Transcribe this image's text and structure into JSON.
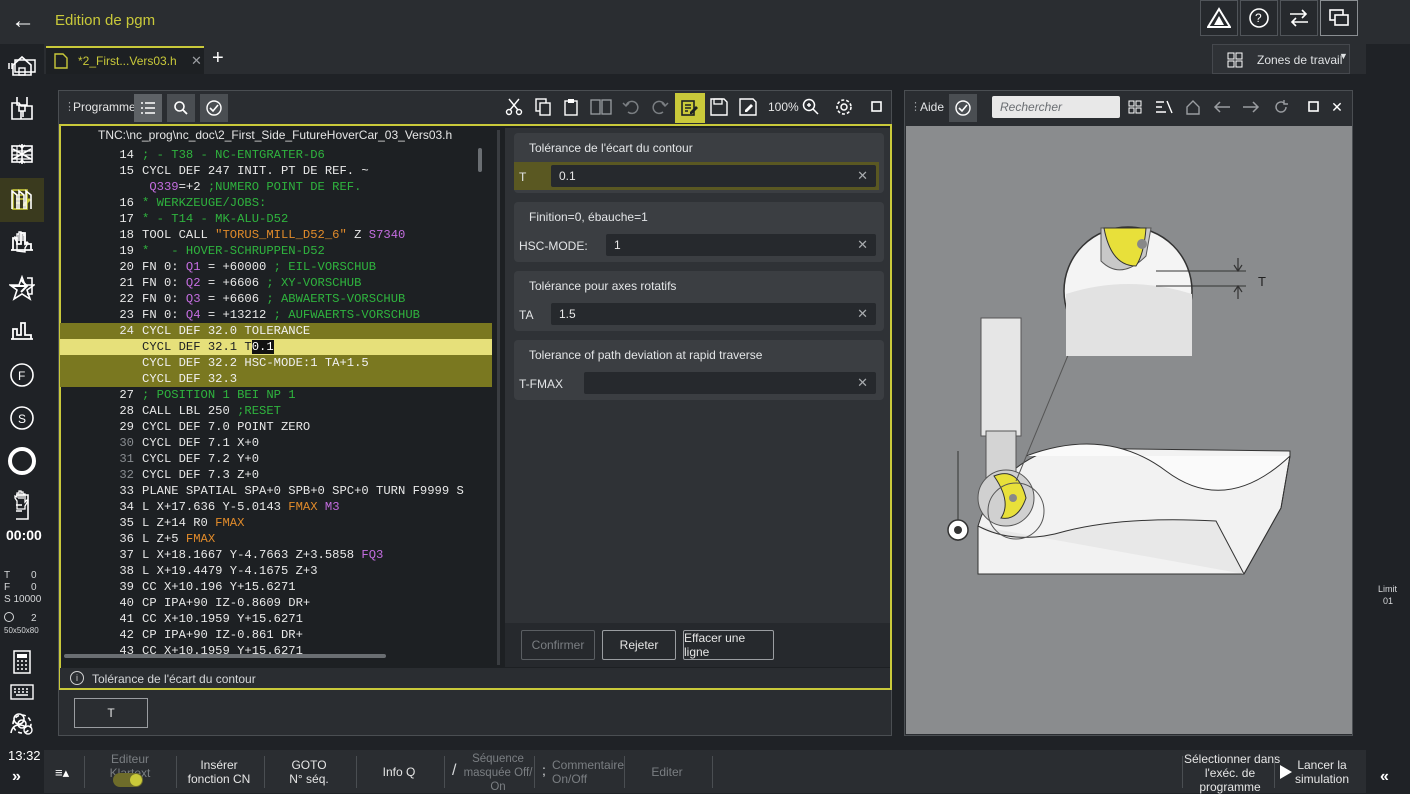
{
  "app": {
    "title": "Edition de pgm"
  },
  "tabs": [
    {
      "label": "*2_First...Vers03.h"
    }
  ],
  "zones": {
    "label": "Zones de travail"
  },
  "program": {
    "label": "Programme",
    "zoom": "100%",
    "path": "TNC:\\nc_prog\\nc_doc\\2_First_Side_FutureHoverCar_03_Vers03.h",
    "lines": [
      {
        "no": "14",
        "segs": [
          [
            "g",
            "; - T38 - NC-ENTGRATER-D6"
          ]
        ]
      },
      {
        "no": "15",
        "segs": [
          [
            "",
            "CYCL DEF 247 INIT. PT DE REF. ~"
          ]
        ]
      },
      {
        "no": "",
        "segs": [
          [
            "q",
            " Q339"
          ],
          [
            "",
            "=+2 "
          ],
          [
            "g",
            ";NUMERO POINT DE REF."
          ]
        ]
      },
      {
        "no": "16",
        "segs": [
          [
            "g",
            "* WERKZEUGE/JOBS:"
          ]
        ]
      },
      {
        "no": "17",
        "segs": [
          [
            "g",
            "* - T14 - MK-ALU-D52"
          ]
        ]
      },
      {
        "no": "18",
        "segs": [
          [
            "",
            "TOOL CALL "
          ],
          [
            "o",
            "\"TORUS_MILL_D52_6\""
          ],
          [
            "",
            " Z "
          ],
          [
            "q",
            "S7340"
          ]
        ]
      },
      {
        "no": "19",
        "segs": [
          [
            "g",
            "*   - HOVER-SCHRUPPEN-D52"
          ]
        ]
      },
      {
        "no": "20",
        "segs": [
          [
            "",
            "FN 0: "
          ],
          [
            "q",
            "Q1"
          ],
          [
            "",
            " = +60000 "
          ],
          [
            "g",
            "; EIL-VORSCHUB"
          ]
        ]
      },
      {
        "no": "21",
        "segs": [
          [
            "",
            "FN 0: "
          ],
          [
            "q",
            "Q2"
          ],
          [
            "",
            " = +6606 "
          ],
          [
            "g",
            "; XY-VORSCHUB"
          ]
        ]
      },
      {
        "no": "22",
        "segs": [
          [
            "",
            "FN 0: "
          ],
          [
            "q",
            "Q3"
          ],
          [
            "",
            " = +6606 "
          ],
          [
            "g",
            "; ABWAERTS-VORSCHUB"
          ]
        ]
      },
      {
        "no": "23",
        "segs": [
          [
            "",
            "FN 0: "
          ],
          [
            "q",
            "Q4"
          ],
          [
            "",
            " = +13212 "
          ],
          [
            "g",
            "; AUFWAERTS-VORSCHUB"
          ]
        ]
      },
      {
        "no": "24",
        "hl": "hl",
        "segs": [
          [
            "",
            "CYCL DEF 32.0 TOLERANCE"
          ]
        ]
      },
      {
        "no": "",
        "hl": "hl2",
        "segs": [
          [
            "dark",
            "CYCL DEF 32.1 T"
          ],
          [
            "cur",
            "0.1"
          ]
        ]
      },
      {
        "no": "",
        "hl": "hl",
        "segs": [
          [
            "",
            "CYCL DEF 32.2 HSC-MODE:1 TA+1.5"
          ]
        ]
      },
      {
        "no": "",
        "hl": "hl",
        "segs": [
          [
            "",
            "CYCL DEF 32.3"
          ]
        ]
      },
      {
        "no": "27",
        "segs": [
          [
            "g",
            "; POSITION 1 BEI NP 1"
          ]
        ]
      },
      {
        "no": "28",
        "segs": [
          [
            "",
            "CALL LBL 250 "
          ],
          [
            "g",
            ";RESET"
          ]
        ]
      },
      {
        "no": "29",
        "segs": [
          [
            "",
            "CYCL DEF 7.0 POINT ZERO"
          ]
        ]
      },
      {
        "no": "30",
        "dimno": true,
        "segs": [
          [
            "",
            "CYCL DEF 7.1 X+0"
          ]
        ]
      },
      {
        "no": "31",
        "dimno": true,
        "segs": [
          [
            "",
            "CYCL DEF 7.2 Y+0"
          ]
        ]
      },
      {
        "no": "32",
        "dimno": true,
        "segs": [
          [
            "",
            "CYCL DEF 7.3 Z+0"
          ]
        ]
      },
      {
        "no": "33",
        "segs": [
          [
            "",
            "PLANE SPATIAL SPA+0 SPB+0 SPC+0 TURN F9999 S"
          ]
        ]
      },
      {
        "no": "34",
        "segs": [
          [
            "",
            "L X+17.636 Y-5.0143 "
          ],
          [
            "o",
            "FMAX"
          ],
          [
            "",
            " "
          ],
          [
            "q",
            "M3"
          ]
        ]
      },
      {
        "no": "35",
        "segs": [
          [
            "",
            "L Z+14 R0 "
          ],
          [
            "o",
            "FMAX"
          ]
        ]
      },
      {
        "no": "36",
        "segs": [
          [
            "",
            "L Z+5 "
          ],
          [
            "o",
            "FMAX"
          ]
        ]
      },
      {
        "no": "37",
        "segs": [
          [
            "",
            "L X+18.1667 Y-4.7663 Z+3.5858 "
          ],
          [
            "q",
            "FQ3"
          ]
        ]
      },
      {
        "no": "38",
        "segs": [
          [
            "",
            "L X+19.4479 Y-4.1675 Z+3"
          ]
        ]
      },
      {
        "no": "39",
        "segs": [
          [
            "",
            "CC X+10.196 Y+15.6271"
          ]
        ]
      },
      {
        "no": "40",
        "segs": [
          [
            "",
            "CP IPA+90 IZ-0.8609 DR+"
          ]
        ]
      },
      {
        "no": "41",
        "segs": [
          [
            "",
            "CC X+10.1959 Y+15.6271"
          ]
        ]
      },
      {
        "no": "42",
        "segs": [
          [
            "",
            "CP IPA+90 IZ-0.861 DR+"
          ]
        ]
      },
      {
        "no": "43",
        "segs": [
          [
            "",
            "CC X+10.1959 Y+15.6271"
          ]
        ]
      }
    ]
  },
  "form": {
    "groups": [
      {
        "title": "Tolérance de l'écart du contour",
        "field": "T",
        "value": "0.1",
        "active": true
      },
      {
        "title": "Finition=0, ébauche=1",
        "field": "HSC-MODE:",
        "value": "1"
      },
      {
        "title": "Tolérance pour axes rotatifs",
        "field": "TA",
        "value": "1.5"
      },
      {
        "title": "Tolerance of path deviation at rapid traverse",
        "field": "T-FMAX",
        "value": ""
      }
    ],
    "buttons": {
      "confirm": "Confirmer",
      "reject": "Rejeter",
      "clear": "Effacer une ligne"
    },
    "info": "Tolérance de l'écart du contour",
    "key": "T"
  },
  "help": {
    "label": "Aide",
    "search_placeholder": "Rechercher",
    "figure_label": "T"
  },
  "status": {
    "timer": "00:00",
    "t": "T",
    "t_val": "0",
    "f": "F",
    "f_val": "0",
    "s": "S 10000",
    "tool_no": "2",
    "dims": "50x50x80",
    "clock": "13:32",
    "limit": "Limit",
    "limit_val": "01"
  },
  "bottom": {
    "klartext": "Editeur Klartext",
    "insert": "Insérer\nfonction CN",
    "goto": "GOTO\nN° séq.",
    "infoq": "Info Q",
    "masked": "Séquence\nmasquée Off/\nOn",
    "comment": "Commentaire\nOn/Off",
    "edit": "Editer",
    "select": "Sélectionner dans\nl'exéc. de\nprogramme",
    "sim": "Lancer la\nsimulation"
  },
  "colors": {
    "accent": "#c9c93a",
    "highlight": "#7a7820"
  }
}
